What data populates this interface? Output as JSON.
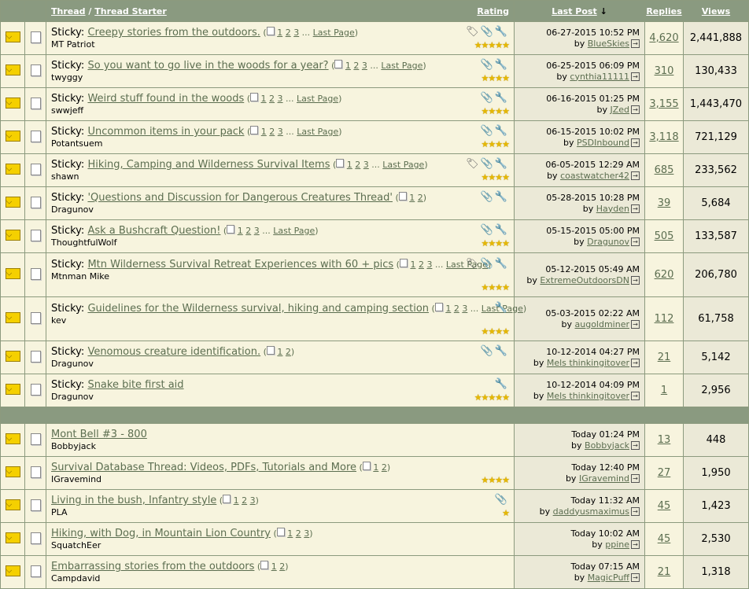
{
  "header": {
    "thread": "Thread",
    "separator": "/",
    "thread_starter": "Thread Starter",
    "rating": "Rating",
    "last_post": "Last Post",
    "sort_arrow": "↓",
    "replies": "Replies",
    "views": "Views"
  },
  "labels": {
    "sticky": "Sticky:",
    "last_page": "Last Page",
    "by": "by",
    "ellipsis": "..."
  },
  "sticky_threads": [
    {
      "title": "Creepy stories from the outdoors.",
      "pages": [
        "1",
        "2",
        "3"
      ],
      "last_page": true,
      "starter": "MT Patriot",
      "date": "06-27-2015 10:52 PM",
      "last_user": "BlueSkies",
      "replies": "4,620",
      "views": "2,441,888",
      "icons": "🏷📎🔧",
      "stars": "★★★★★"
    },
    {
      "title": "So you want to go live in the woods for a year?",
      "pages": [
        "1",
        "2",
        "3"
      ],
      "last_page": true,
      "starter": "twyggy",
      "date": "06-25-2015 06:09 PM",
      "last_user": "cynthia11111",
      "replies": "310",
      "views": "130,433",
      "icons": "📎🔧",
      "stars": "★★★★"
    },
    {
      "title": "Weird stuff found in the woods",
      "pages": [
        "1",
        "2",
        "3"
      ],
      "last_page": true,
      "starter": "swwjeff",
      "date": "06-16-2015 01:25 PM",
      "last_user": "JZed",
      "replies": "3,155",
      "views": "1,443,470",
      "icons": "📎🔧",
      "stars": "★★★★"
    },
    {
      "title": "Uncommon items in your pack",
      "pages": [
        "1",
        "2",
        "3"
      ],
      "last_page": true,
      "starter": "Potantsuem",
      "date": "06-15-2015 10:02 PM",
      "last_user": "PSDInbound",
      "replies": "3,118",
      "views": "721,129",
      "icons": "📎🔧",
      "stars": "★★★★"
    },
    {
      "title": "Hiking, Camping and Wilderness Survival Items",
      "pages": [
        "1",
        "2",
        "3"
      ],
      "last_page": true,
      "starter": "shawn",
      "date": "06-05-2015 12:29 AM",
      "last_user": "coastwatcher42",
      "replies": "685",
      "views": "233,562",
      "icons": "🏷📎🔧",
      "stars": "★★★★"
    },
    {
      "title": "'Questions and Discussion for Dangerous Creatures Thread'",
      "pages": [
        "1",
        "2"
      ],
      "last_page": false,
      "starter": "Dragunov",
      "date": "05-28-2015 10:28 PM",
      "last_user": "Hayden",
      "replies": "39",
      "views": "5,684",
      "icons": "📎🔧",
      "stars": ""
    },
    {
      "title": "Ask a Bushcraft Question!",
      "pages": [
        "1",
        "2",
        "3"
      ],
      "last_page": true,
      "starter": "ThoughtfulWolf",
      "date": "05-15-2015 05:00 PM",
      "last_user": "Dragunov",
      "replies": "505",
      "views": "133,587",
      "icons": "📎🔧",
      "stars": "★★★★"
    },
    {
      "title": "Mtn Wilderness Survival Retreat Experiences with 60 + pics",
      "pages": [
        "1",
        "2",
        "3"
      ],
      "last_page": true,
      "starter": "Mtnman Mike",
      "date": "05-12-2015 05:49 AM",
      "last_user": "ExtremeOutdoorsDN",
      "replies": "620",
      "views": "206,780",
      "icons": "🏷📎🔧",
      "stars": "★★★★"
    },
    {
      "title": "Guidelines for the Wilderness survival, hiking and camping section",
      "pages": [
        "1",
        "2",
        "3"
      ],
      "last_page": true,
      "starter": "kev",
      "date": "05-03-2015 02:22 AM",
      "last_user": "augoldminer",
      "replies": "112",
      "views": "61,758",
      "icons": "🔧",
      "stars": "★★★★"
    },
    {
      "title": "Venomous creature identification.",
      "pages": [
        "1",
        "2"
      ],
      "last_page": false,
      "starter": "Dragunov",
      "date": "10-12-2014 04:27 PM",
      "last_user": "Mels thinkingitover",
      "replies": "21",
      "views": "5,142",
      "icons": "📎🔧",
      "stars": ""
    },
    {
      "title": "Snake bite first aid",
      "pages": [],
      "last_page": false,
      "starter": "Dragunov",
      "date": "10-12-2014 04:09 PM",
      "last_user": "Mels thinkingitover",
      "replies": "1",
      "views": "2,956",
      "icons": "🔧",
      "stars": "★★★★★"
    }
  ],
  "normal_threads": [
    {
      "title": "Mont Bell #3 - 800",
      "pages": [],
      "last_page": false,
      "starter": "Bobbyjack",
      "date": "Today 01:24 PM",
      "last_user": "Bobbyjack",
      "replies": "13",
      "views": "448",
      "icons": "",
      "stars": ""
    },
    {
      "title": "Survival Database Thread: Videos, PDFs, Tutorials and More",
      "pages": [
        "1",
        "2"
      ],
      "last_page": false,
      "starter": "IGravemind",
      "date": "Today 12:40 PM",
      "last_user": "IGravemind",
      "replies": "27",
      "views": "1,950",
      "icons": "",
      "stars": "★★★★"
    },
    {
      "title": "Living in the bush, Infantry style",
      "pages": [
        "1",
        "2",
        "3"
      ],
      "last_page": false,
      "starter": "PLA",
      "date": "Today 11:32 AM",
      "last_user": "daddyusmaximus",
      "replies": "45",
      "views": "1,423",
      "icons": "📎",
      "stars": "★"
    },
    {
      "title": "Hiking, with Dog, in Mountain Lion Country",
      "pages": [
        "1",
        "2",
        "3"
      ],
      "last_page": false,
      "starter": "SquatchEer",
      "date": "Today 10:02 AM",
      "last_user": "ppine",
      "replies": "45",
      "views": "2,530",
      "icons": "",
      "stars": ""
    },
    {
      "title": "Embarrassing stories from the outdoors",
      "pages": [
        "1",
        "2"
      ],
      "last_page": false,
      "starter": "Campdavid",
      "date": "Today 07:15 AM",
      "last_user": "MagicPuff",
      "replies": "21",
      "views": "1,318",
      "icons": "",
      "stars": ""
    }
  ]
}
